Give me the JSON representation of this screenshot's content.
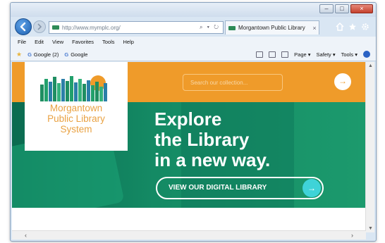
{
  "browser": {
    "address_url": "http://www.mymplc.org/",
    "address_tools": "⌕ ▾ ↻",
    "tab_label": "Morgantown Public Library",
    "tab_close": "×",
    "window_controls": [
      "–",
      "□",
      "×"
    ],
    "toolbar_icons": [
      "home-icon",
      "star-icon",
      "gear-icon"
    ]
  },
  "menu": {
    "items": [
      "File",
      "Edit",
      "View",
      "Favorites",
      "Tools",
      "Help"
    ]
  },
  "favorites": {
    "items": [
      "Google (2)",
      "Google"
    ]
  },
  "command_bar": {
    "items": [
      "Page ▾",
      "Safety ▾",
      "Tools ▾"
    ]
  },
  "site": {
    "search_placeholder": "Search our collection...",
    "search_go": "→",
    "logo_lines": [
      "Morgantown",
      "Public Library",
      "System"
    ],
    "hero_lines": [
      "Explore",
      "the Library",
      "in a new way."
    ],
    "cta_label": "VIEW OUR DIGITAL LIBRARY",
    "cta_arrow": "→"
  },
  "scrollbars": {
    "up": "▲",
    "down": "▼",
    "left": "‹",
    "right": "›"
  },
  "colors": {
    "orange": "#ef9b2a",
    "green": "#148a64",
    "teal": "#3fd3d8",
    "logo_text": "#e9a243"
  }
}
